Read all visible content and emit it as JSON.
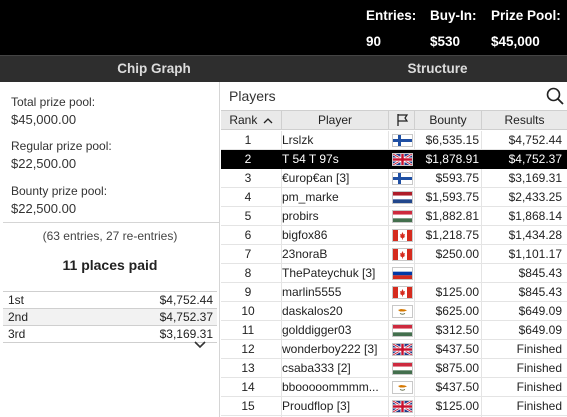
{
  "header": {
    "entries_label": "Entries:",
    "entries_value": "90",
    "buyin_label": "Buy-In:",
    "buyin_value": "$530",
    "prizepool_label": "Prize Pool:",
    "prizepool_value": "$45,000"
  },
  "tabs": {
    "chip_graph": "Chip Graph",
    "structure": "Structure"
  },
  "summary": {
    "total_label": "Total prize pool:",
    "total_value": "$45,000.00",
    "regular_label": "Regular prize pool:",
    "regular_value": "$22,500.00",
    "bounty_label": "Bounty prize pool:",
    "bounty_value": "$22,500.00",
    "entries_note": "(63 entries, 27 re-entries)",
    "places_paid": "11 places paid"
  },
  "payouts": [
    {
      "place": "1st",
      "amount": "$4,752.44"
    },
    {
      "place": "2nd",
      "amount": "$4,752.37"
    },
    {
      "place": "3rd",
      "amount": "$3,169.31"
    }
  ],
  "players_panel": {
    "title": "Players",
    "columns": {
      "rank": "Rank",
      "player": "Player",
      "bounty": "Bounty",
      "results": "Results"
    }
  },
  "players": [
    {
      "rank": "1",
      "name": "Lrslzk",
      "flag": "finland",
      "bounty": "$6,535.15",
      "result": "$4,752.44"
    },
    {
      "rank": "2",
      "name": "T 54 T 97s",
      "flag": "uk",
      "bounty": "$1,878.91",
      "result": "$4,752.37"
    },
    {
      "rank": "3",
      "name": "€urop€an [3]",
      "flag": "finland",
      "bounty": "$593.75",
      "result": "$3,169.31"
    },
    {
      "rank": "4",
      "name": "pm_marke",
      "flag": "netherlands",
      "bounty": "$1,593.75",
      "result": "$2,433.25"
    },
    {
      "rank": "5",
      "name": "probirs",
      "flag": "hungary",
      "bounty": "$1,882.81",
      "result": "$1,868.14"
    },
    {
      "rank": "6",
      "name": "bigfox86",
      "flag": "canada",
      "bounty": "$1,218.75",
      "result": "$1,434.28"
    },
    {
      "rank": "7",
      "name": "23noraB",
      "flag": "canada",
      "bounty": "$250.00",
      "result": "$1,101.17"
    },
    {
      "rank": "8",
      "name": "ThePateychuk [3]",
      "flag": "russia",
      "bounty": "",
      "result": "$845.43"
    },
    {
      "rank": "9",
      "name": "marlin5555",
      "flag": "canada",
      "bounty": "$125.00",
      "result": "$845.43"
    },
    {
      "rank": "10",
      "name": "daskalos20",
      "flag": "cyprus",
      "bounty": "$625.00",
      "result": "$649.09"
    },
    {
      "rank": "11",
      "name": "golddigger03",
      "flag": "hungary",
      "bounty": "$312.50",
      "result": "$649.09"
    },
    {
      "rank": "12",
      "name": "wonderboy222 [3]",
      "flag": "uk",
      "bounty": "$437.50",
      "result": "Finished"
    },
    {
      "rank": "13",
      "name": "csaba333 [2]",
      "flag": "hungary",
      "bounty": "$875.00",
      "result": "Finished"
    },
    {
      "rank": "14",
      "name": "bbooooommmm...",
      "flag": "cyprus",
      "bounty": "$437.50",
      "result": "Finished"
    },
    {
      "rank": "15",
      "name": "Proudflop [3]",
      "flag": "uk",
      "bounty": "$125.00",
      "result": "Finished"
    }
  ],
  "icons": {
    "search": "search-icon",
    "flag_column": "flag-icon",
    "sort": "sort-ascending-icon",
    "expand": "chevron-down-icon"
  },
  "colors": {
    "topbar": "#000000",
    "tabbar": "#2e2e2e",
    "selected_row": "#000000",
    "header_row": "#e9e9e9"
  }
}
